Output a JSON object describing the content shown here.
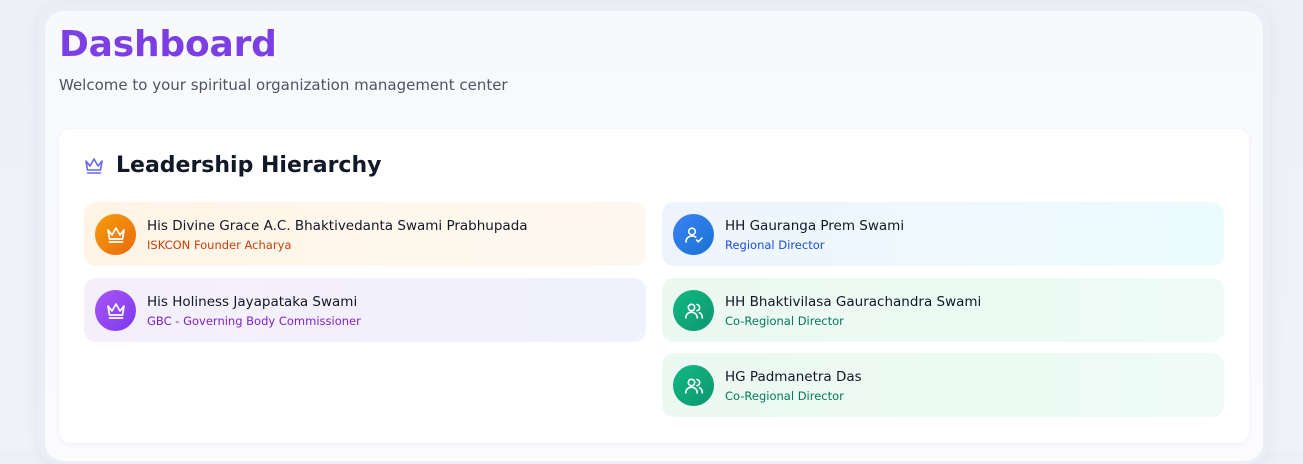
{
  "header": {
    "title": "Dashboard",
    "subtitle": "Welcome to your spiritual organization management center"
  },
  "leadership": {
    "title": "Leadership Hierarchy",
    "icon": "crown-icon",
    "left_column": [
      {
        "name": "His Divine Grace A.C. Bhaktivedanta Swami Prabhupada",
        "role": "ISKCON Founder Acharya",
        "icon": "crown-icon",
        "color": "#ea6a0c"
      },
      {
        "name": "His Holiness Jayapataka Swami",
        "role": "GBC - Governing Body Commissioner",
        "icon": "crown-icon",
        "color": "#7c3aed"
      }
    ],
    "right_column": [
      {
        "name": "HH Gauranga Prem Swami",
        "role": "Regional Director",
        "icon": "user-check-icon",
        "color": "#1a73d1"
      },
      {
        "name": "HH Bhaktivilasa Gaurachandra Swami",
        "role": "Co-Regional Director",
        "icon": "users-icon",
        "color": "#0e9670"
      },
      {
        "name": "HG Padmanetra Das",
        "role": "Co-Regional Director",
        "icon": "users-icon",
        "color": "#0e9670"
      }
    ]
  },
  "colors": {
    "title_purple": "#7b3fe4",
    "accent_indigo": "#6366f1"
  }
}
